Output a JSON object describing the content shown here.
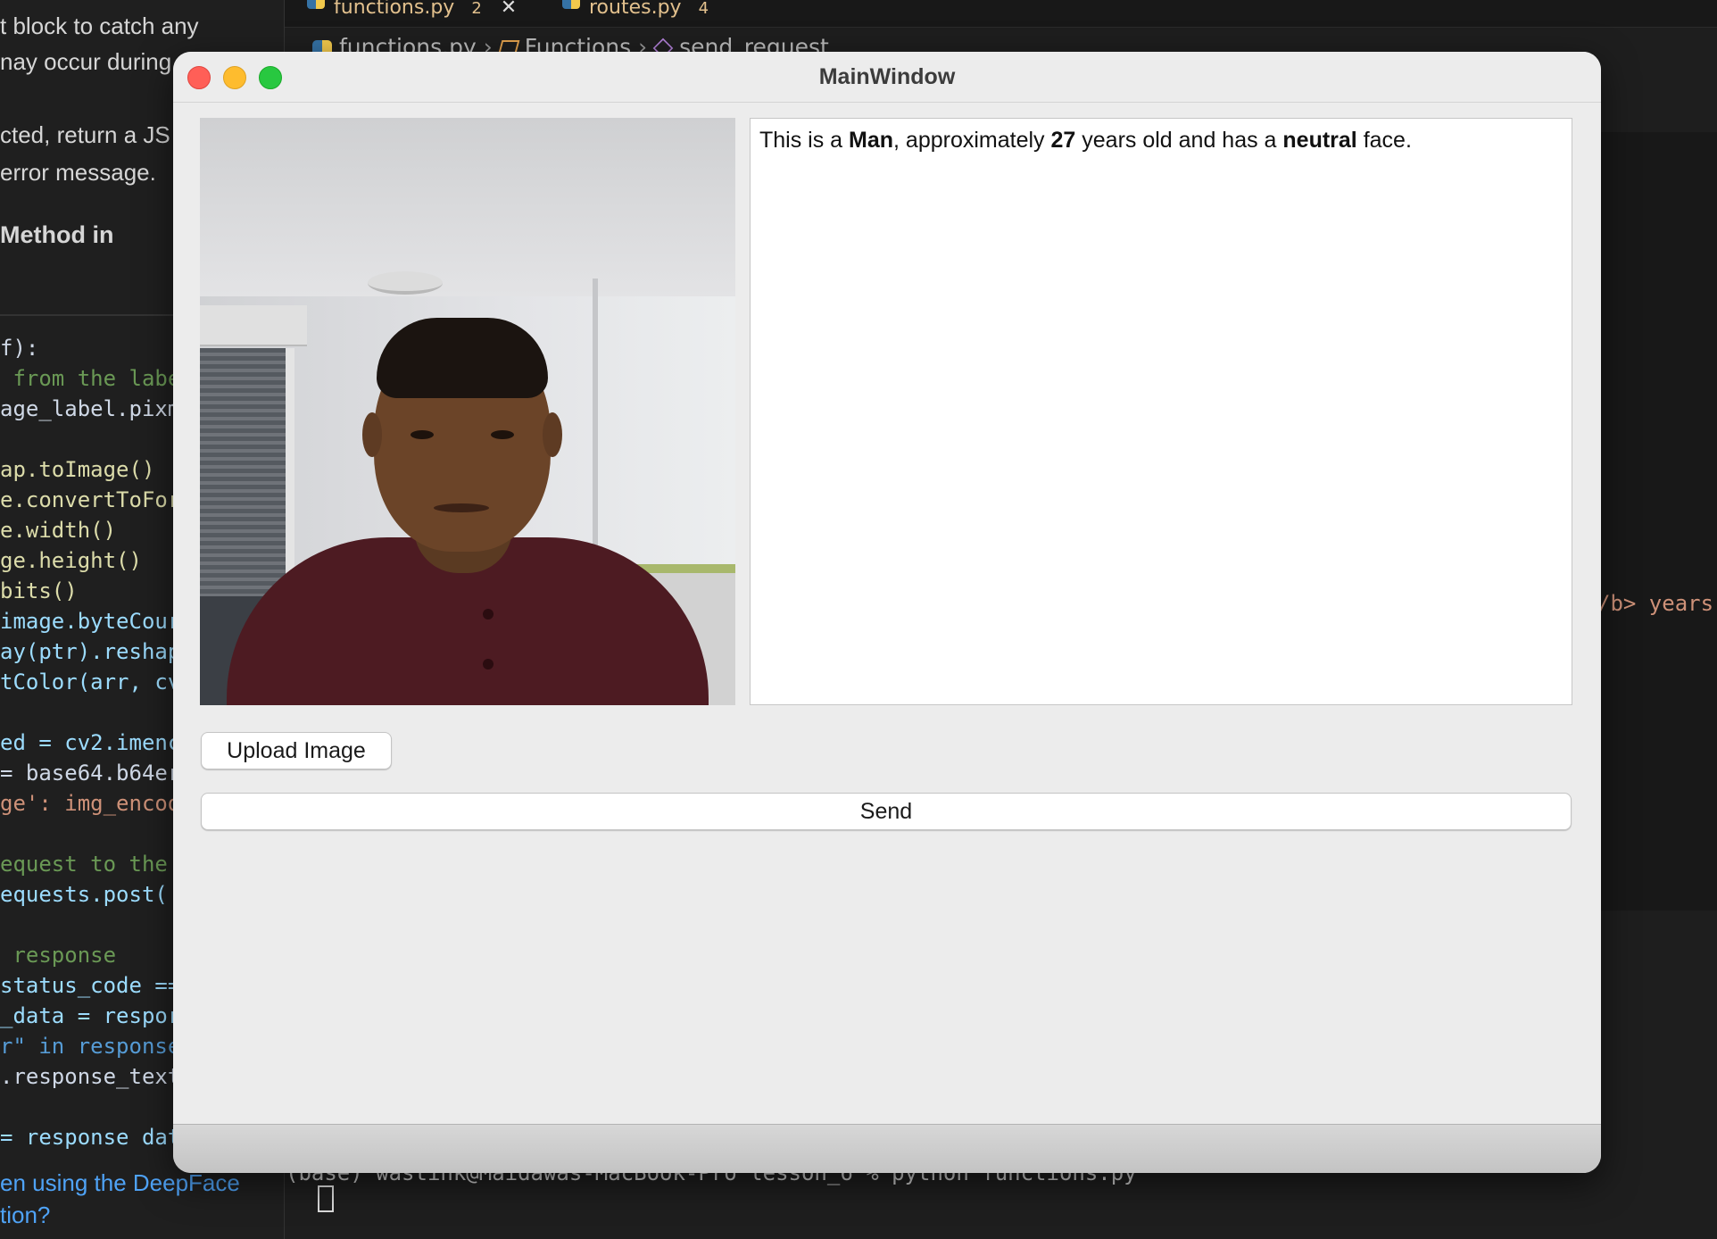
{
  "ide": {
    "tabs": [
      {
        "label": "functions.py",
        "marker": "2",
        "close": "✕"
      },
      {
        "label": "routes.py",
        "marker": "4"
      }
    ],
    "breadcrumb": [
      "functions.py",
      "Functions",
      "send_request"
    ],
    "chat_lines": [
      {
        "text": "t block to catch any",
        "style": "normal"
      },
      {
        "text": "nay occur during",
        "style": "normal"
      },
      {
        "text": "cted, return a JS",
        "style": "normal"
      },
      {
        "text": " error message.",
        "style": "normal"
      },
      {
        "text": " Method in",
        "style": "bold"
      }
    ],
    "chat_links": [
      "en using the DeepFace",
      "tion?"
    ],
    "code_lines": [
      "f):",
      " from the labe",
      "age_label.pixm",
      "",
      "ap.toImage()",
      "e.convertToFor",
      "e.width()",
      "ge.height()",
      "bits()",
      "image.byteCour",
      "ay(ptr).reshap",
      "tColor(arr, cv",
      "",
      "ed = cv2.imenc",
      "= base64.b64er",
      "ge': img_encod",
      "",
      "equest to the",
      "equests.post('",
      "",
      " response",
      "status_code ==",
      "_data = respor",
      "r\" in response",
      ".response_text",
      "",
      "= response dat"
    ],
    "right_snippet": "/b> years",
    "terminal_line": "(base) wastink@Maidawas-MacBook-Pro lesson_6 % python functions.py"
  },
  "window": {
    "title": "MainWindow",
    "result": {
      "prefix": "This is a ",
      "gender": "Man",
      "mid1": ", approximately ",
      "age": "27",
      "mid2": " years old and has a ",
      "emotion": "neutral",
      "suffix": " face."
    },
    "upload_label": "Upload Image",
    "send_label": "Send"
  }
}
